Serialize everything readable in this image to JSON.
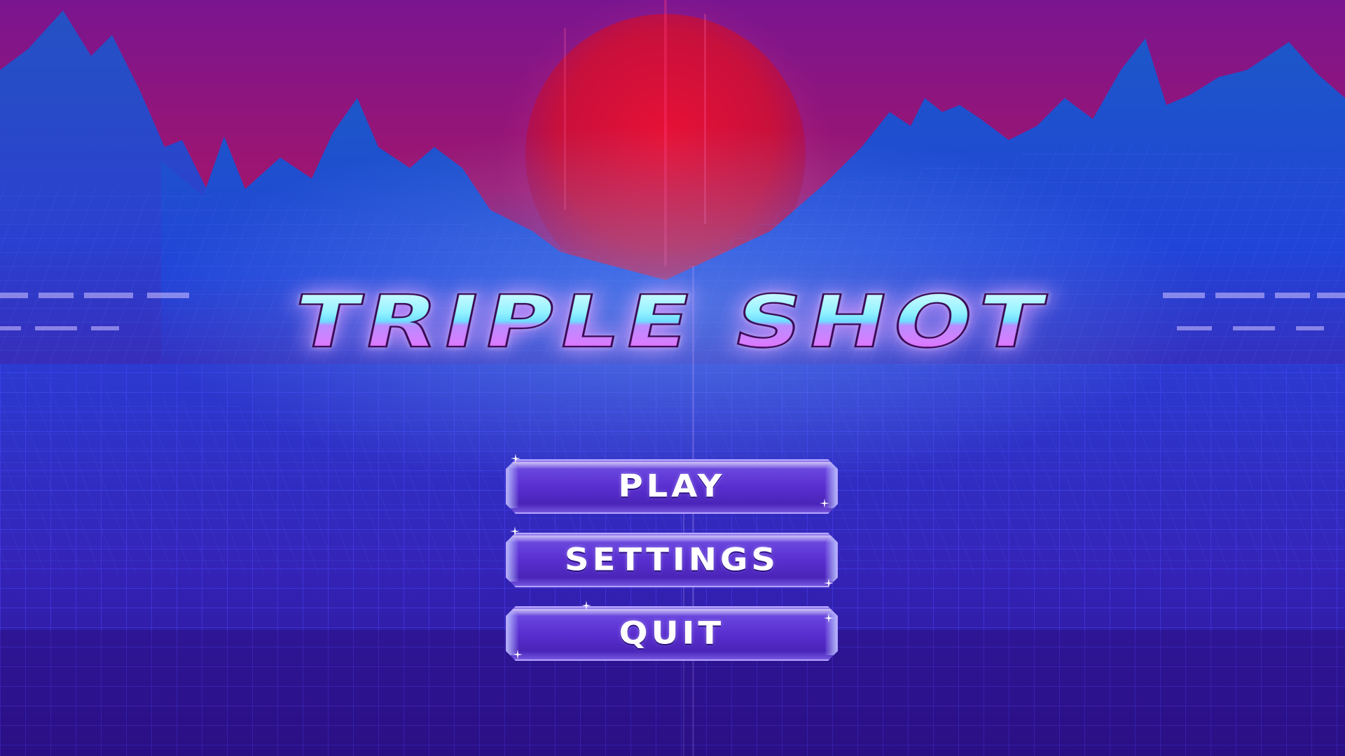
{
  "title": "TRIPLE SHOT",
  "menu": {
    "play_label": "PLAY",
    "settings_label": "SETTINGS",
    "quit_label": "QUIT"
  },
  "colors": {
    "sky_top": "#7a1590",
    "sun": "#d8103a",
    "mountain": "#1f4fd8",
    "grid_line": "#3d3bff",
    "floor": "#3a1fb0",
    "button_fill": "#5a2fd0",
    "title_top": "#8ff2ff",
    "title_bottom": "#c64dff"
  },
  "icons": [
    "sparkle-icon"
  ]
}
